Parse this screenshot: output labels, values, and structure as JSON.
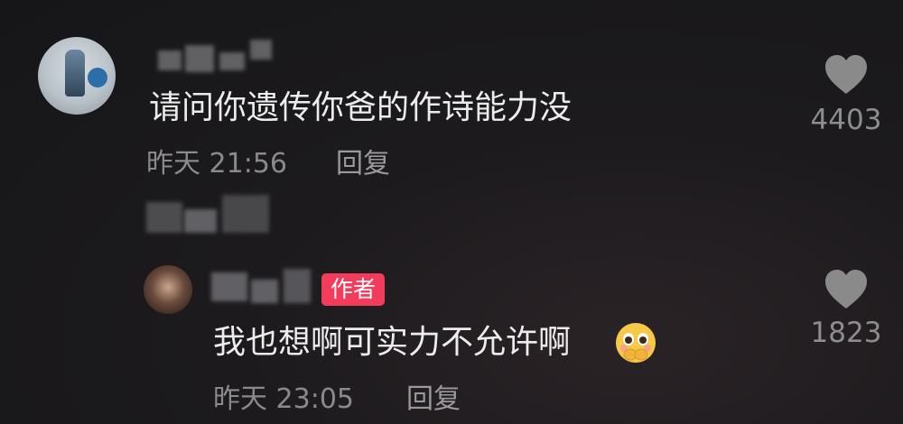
{
  "comment": {
    "text": "请问你遗传你爸的作诗能力没",
    "time": "昨天 21:56",
    "reply_label": "回复",
    "likes": "4403",
    "heart_icon": "heart-icon"
  },
  "reply": {
    "text": "我也想啊可实力不允许啊",
    "emoji": "pleading-face-emoji",
    "badge": "作者",
    "time": "昨天 23:05",
    "reply_label": "回复",
    "likes": "1823",
    "heart_icon": "heart-icon"
  },
  "colors": {
    "background": "#1c1a1d",
    "text": "#ececec",
    "meta": "#8a8a8a",
    "badge": "#f33b5c"
  }
}
